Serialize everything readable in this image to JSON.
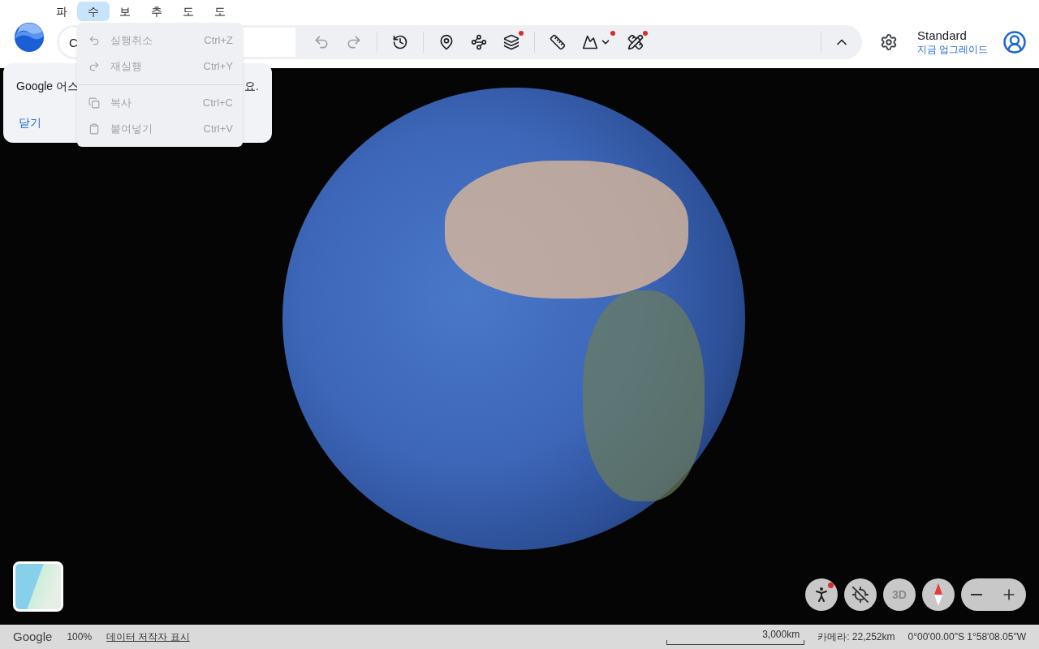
{
  "menu_bar": [
    {
      "label": "파",
      "selected": false
    },
    {
      "label": "수",
      "selected": true
    },
    {
      "label": "보",
      "selected": false
    },
    {
      "label": "추",
      "selected": false
    },
    {
      "label": "도",
      "selected": false
    },
    {
      "label": "도",
      "selected": false
    }
  ],
  "search": {
    "placeholder": "C"
  },
  "toolbar": [
    {
      "disabled": true,
      "notification": false,
      "dropdown": false
    },
    {
      "disabled": true,
      "notification": false,
      "dropdown": false
    },
    {
      "disabled": false,
      "notification": false,
      "dropdown": false
    },
    {
      "disabled": false,
      "notification": false,
      "dropdown": false
    },
    {
      "disabled": false,
      "notification": false,
      "dropdown": false
    },
    {
      "disabled": false,
      "notification": true,
      "dropdown": false
    },
    {
      "disabled": false,
      "notification": false,
      "dropdown": false
    },
    {
      "disabled": false,
      "notification": true,
      "dropdown": true
    },
    {
      "disabled": false,
      "notification": true,
      "dropdown": false
    }
  ],
  "account": {
    "plan": "Standard",
    "upgrade": "지금 업그레이드"
  },
  "tip": {
    "text_start": "Google 어스",
    "text_end": "요.",
    "close": "닫기"
  },
  "edit_menu": [
    {
      "label": "실행취소",
      "shortcut": "Ctrl+Z",
      "disabled": true,
      "separator_before": false
    },
    {
      "label": "재실행",
      "shortcut": "Ctrl+Y",
      "disabled": true,
      "separator_before": false
    },
    {
      "label": "복사",
      "shortcut": "Ctrl+C",
      "disabled": true,
      "separator_before": true
    },
    {
      "label": "붙여넣기",
      "shortcut": "Ctrl+V",
      "disabled": true,
      "separator_before": false
    }
  ],
  "map_controls": {
    "pegman_notification": true,
    "view_3d": "3D"
  },
  "status_bar": {
    "brand": "Google",
    "zoom": "100%",
    "attribution": "데이터 저작자 표시",
    "scale": "3,000km",
    "camera": "카메라: 22,252km",
    "coordinates": "0°00'00.00\"S 1°58'08.05\"W"
  }
}
